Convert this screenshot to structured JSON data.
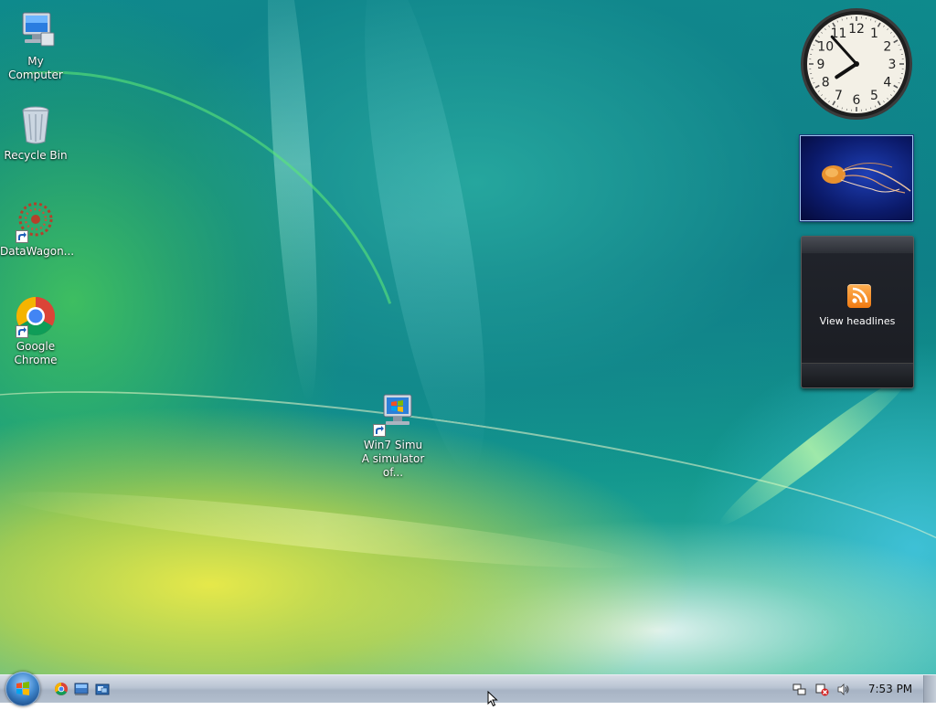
{
  "desktop": {
    "icons": [
      {
        "label": "My Computer",
        "icon": "computer-icon"
      },
      {
        "label": "Recycle Bin",
        "icon": "recycle-bin-icon"
      },
      {
        "label": "DataWagon...",
        "icon": "datawagon-icon",
        "shortcut": true
      },
      {
        "label": "Google Chrome",
        "icon": "chrome-icon",
        "shortcut": true
      },
      {
        "label": "Win7 Simu   A simulator of...",
        "icon": "win7-simulator-icon",
        "shortcut": true
      }
    ]
  },
  "gadgets": {
    "clock": {
      "numerals": [
        "12",
        "1",
        "2",
        "3",
        "4",
        "5",
        "6",
        "7",
        "8",
        "9",
        "10",
        "11"
      ],
      "time": "7:53"
    },
    "slideshow": {
      "image": "jellyfish-image"
    },
    "feed": {
      "view_headlines": "View headlines",
      "icon": "rss-icon"
    }
  },
  "taskbar": {
    "start": "start-orb-icon",
    "quick_launch": [
      "chrome-icon",
      "show-desktop-icon",
      "switch-windows-icon"
    ],
    "tray": {
      "icons": [
        "network-icon",
        "network-error-icon",
        "volume-icon"
      ],
      "time": "7:53 PM"
    }
  },
  "colors": {
    "accent": "#1d4f8c",
    "taskbar": "#b8c3d2",
    "rss": "#f07a12"
  }
}
